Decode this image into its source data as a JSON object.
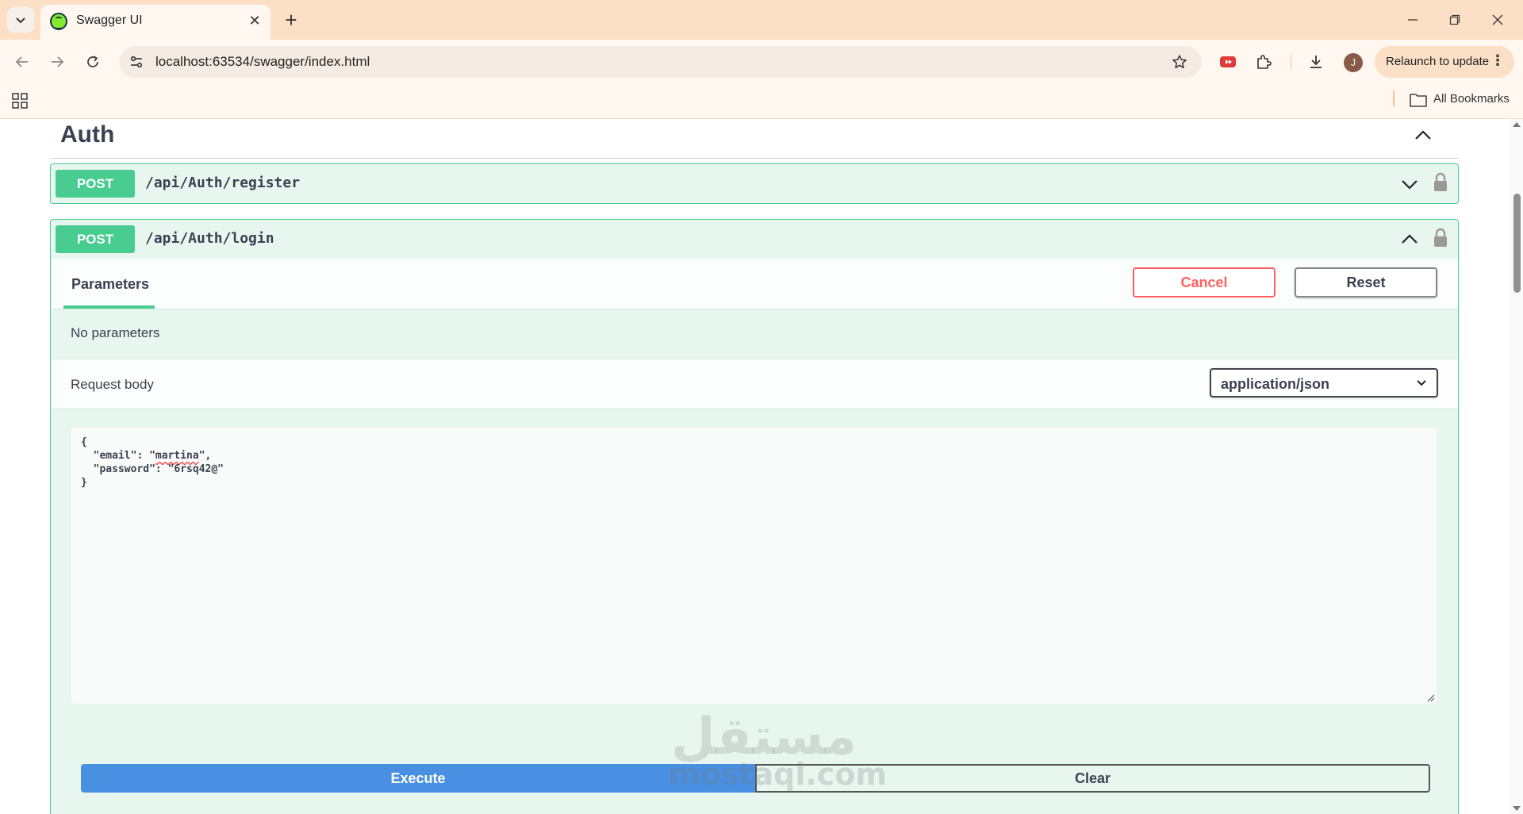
{
  "browser": {
    "tab_title": "Swagger UI",
    "url": "localhost:63534/swagger/index.html",
    "relaunch_label": "Relaunch to update",
    "avatar_letter": "J",
    "bookmarks_label": "All Bookmarks",
    "icons": [
      "tab-list-icon",
      "swagger-favicon",
      "close-icon",
      "plus-icon",
      "minimize-icon",
      "restore-icon",
      "back-arrow-icon",
      "forward-arrow-icon",
      "reload-icon",
      "site-settings-icon",
      "star-icon",
      "youtube-extension-icon",
      "puzzle-extensions-icon",
      "download-icon",
      "more-vert-icon",
      "apps-grid-icon",
      "folder-icon"
    ]
  },
  "section": {
    "title": "Auth"
  },
  "operations": [
    {
      "method": "POST",
      "path": "/api/Auth/register",
      "expanded": false
    },
    {
      "method": "POST",
      "path": "/api/Auth/login",
      "expanded": true,
      "tab_label": "Parameters",
      "cancel_label": "Cancel",
      "reset_label": "Reset",
      "no_parameters": "No parameters",
      "request_body_label": "Request body",
      "content_type": "application/json",
      "body_lines": {
        "open": "{",
        "email_key": "  \"email\": \"",
        "email_value": "martina",
        "email_end": "\",",
        "password": "  \"password\": \"6rsq42@\"",
        "close": "}"
      },
      "execute_label": "Execute",
      "clear_label": "Clear"
    }
  ],
  "colors": {
    "post": "#49cc90",
    "execute": "#4990e2",
    "cancel": "#ff6060",
    "tabstrip": "#fbe0c6"
  },
  "watermark": {
    "arabic": "مستقل",
    "latin": "mostaql.com"
  }
}
